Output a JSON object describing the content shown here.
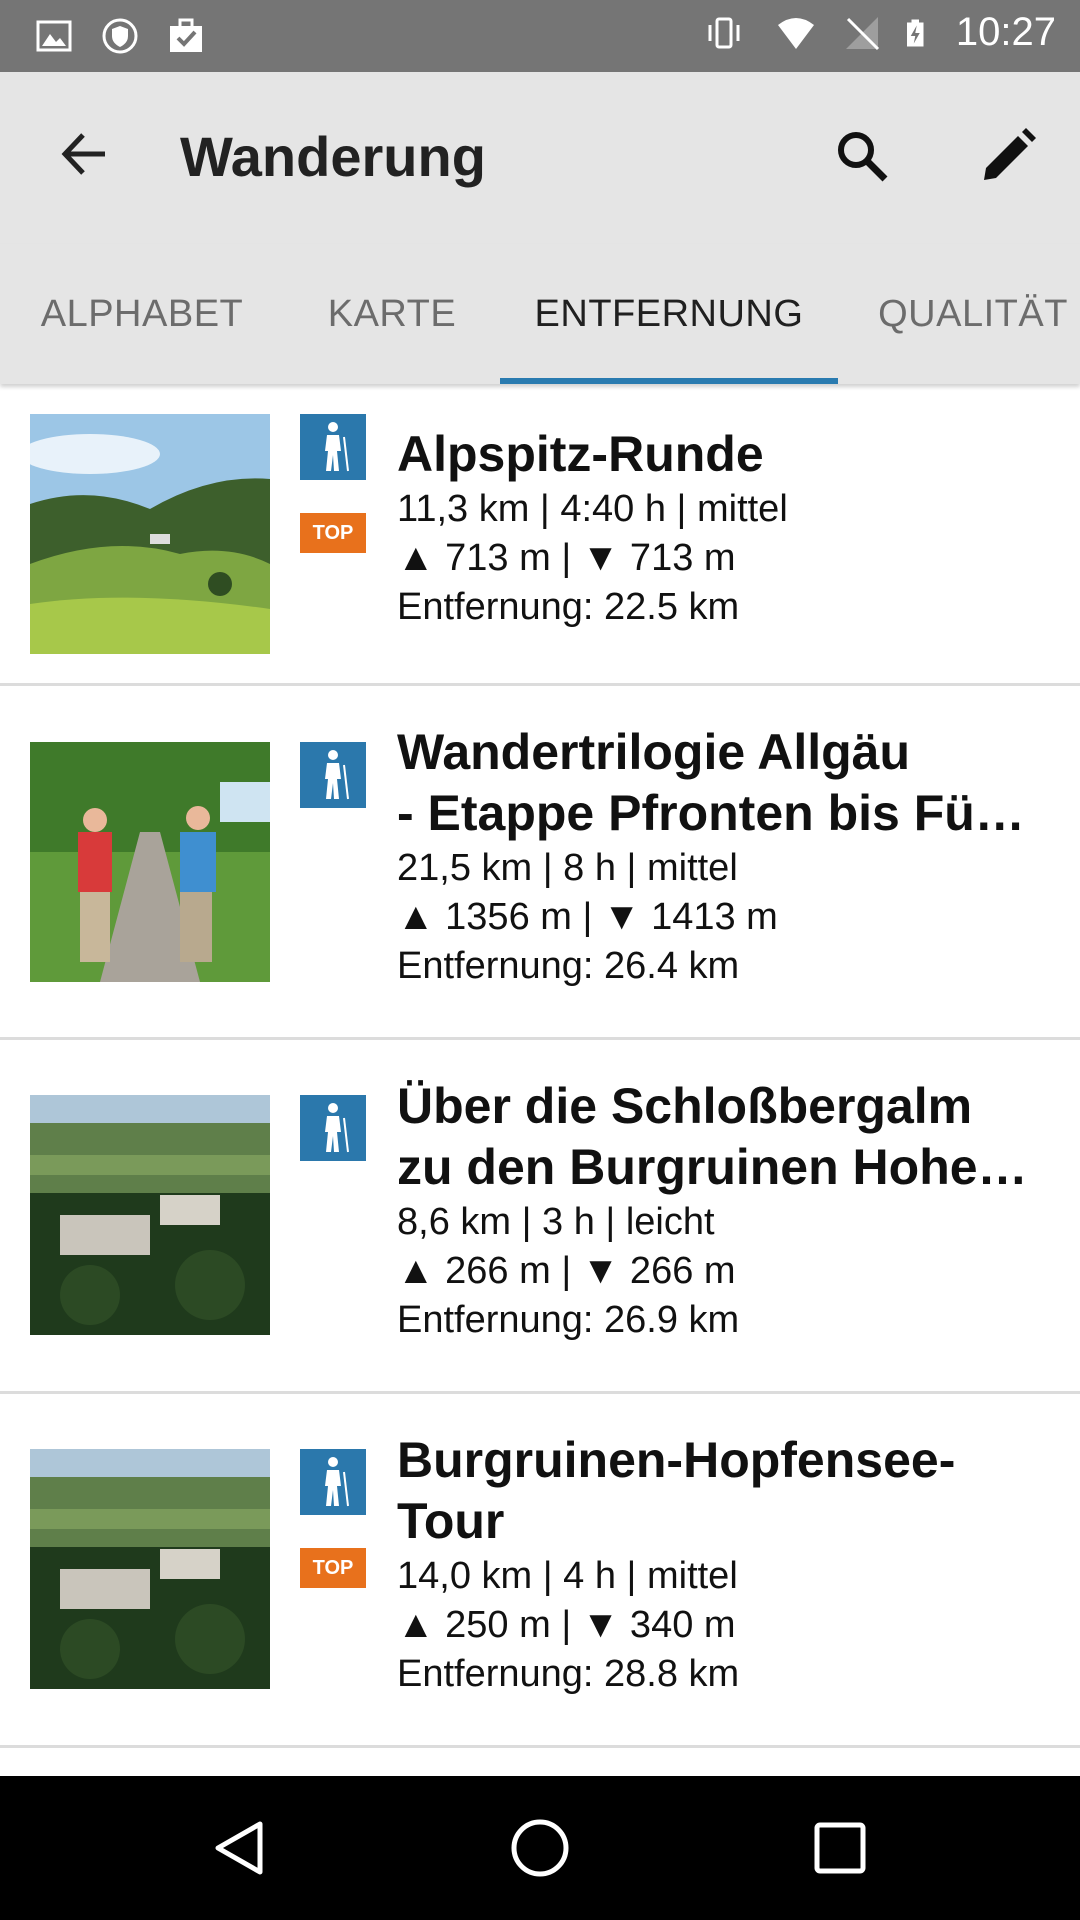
{
  "status_bar": {
    "time": "10:27"
  },
  "app_bar": {
    "title": "Wanderung"
  },
  "tabs": [
    {
      "label": "ALPHABET",
      "active": false
    },
    {
      "label": "KARTE",
      "active": false
    },
    {
      "label": "ENTFERNUNG",
      "active": true
    },
    {
      "label": "QUALITÄT",
      "active": false
    }
  ],
  "accent_color": "#2a7bb0",
  "top_badge_color": "#e8711c",
  "tours": [
    {
      "name_lines": [
        "Alpspitz-Runde"
      ],
      "stats": "11,3 km | 4:40 h | mittel",
      "elevation": "▲ 713 m | ▼ 713 m",
      "distance": "Entfernung: 22.5 km",
      "top": true,
      "top_label": "TOP",
      "image": "meadow-landscape"
    },
    {
      "name_lines": [
        "Wandertrilogie Allgäu",
        "- Etappe Pfronten bis Füs…"
      ],
      "stats": "21,5 km | 8 h | mittel",
      "elevation": "▲ 1356 m | ▼ 1413 m",
      "distance": "Entfernung: 26.4 km",
      "top": false,
      "image": "hikers-on-path"
    },
    {
      "name_lines": [
        "Über die Schloßbergalm",
        "zu den Burgruinen Hohen…"
      ],
      "stats": "8,6 km | 3 h | leicht",
      "elevation": "▲ 266 m | ▼ 266 m",
      "distance": "Entfernung: 26.9 km",
      "top": false,
      "image": "castle-ruins-aerial"
    },
    {
      "name_lines": [
        "Burgruinen-Hopfensee-",
        "Tour"
      ],
      "stats": "14,0 km | 4 h | mittel",
      "elevation": "▲ 250 m | ▼ 340 m",
      "distance": "Entfernung: 28.8 km",
      "top": true,
      "top_label": "TOP",
      "image": "castle-ruins-aerial"
    }
  ]
}
